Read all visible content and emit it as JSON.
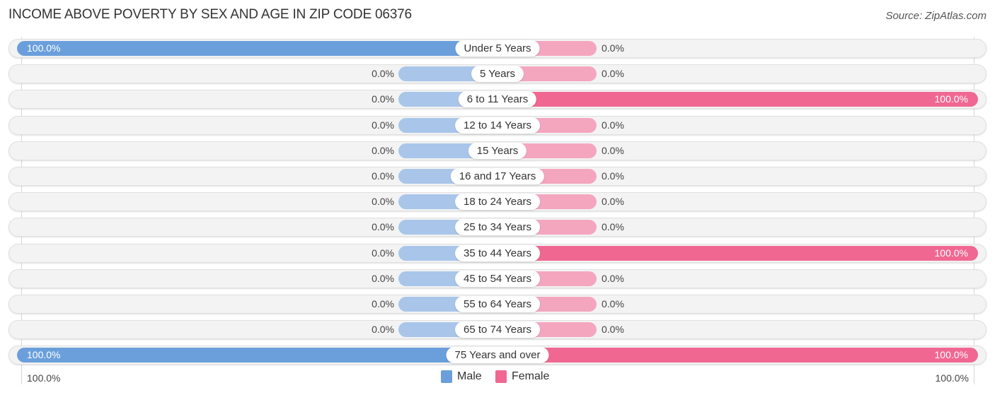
{
  "title": "INCOME ABOVE POVERTY BY SEX AND AGE IN ZIP CODE 06376",
  "source": "Source: ZipAtlas.com",
  "colors": {
    "male_full": "#6a9fdb",
    "male_stub": "#a9c6ea",
    "female_full": "#f06892",
    "female_stub": "#f5a6bf"
  },
  "legend": {
    "male": "Male",
    "female": "Female"
  },
  "axis": {
    "left_label": "100.0%",
    "right_label": "100.0%"
  },
  "chart_data": {
    "type": "bar",
    "orientation": "horizontal-diverging",
    "title": "INCOME ABOVE POVERTY BY SEX AND AGE IN ZIP CODE 06376",
    "xlabel": "",
    "ylabel": "",
    "xlim": [
      -100,
      100
    ],
    "legend_position": "bottom-center",
    "categories": [
      "Under 5 Years",
      "5 Years",
      "6 to 11 Years",
      "12 to 14 Years",
      "15 Years",
      "16 and 17 Years",
      "18 to 24 Years",
      "25 to 34 Years",
      "35 to 44 Years",
      "45 to 54 Years",
      "55 to 64 Years",
      "65 to 74 Years",
      "75 Years and over"
    ],
    "series": [
      {
        "name": "Male",
        "values": [
          100,
          0,
          0,
          0,
          0,
          0,
          0,
          0,
          0,
          0,
          0,
          0,
          100
        ],
        "labels": [
          "100.0%",
          "0.0%",
          "0.0%",
          "0.0%",
          "0.0%",
          "0.0%",
          "0.0%",
          "0.0%",
          "0.0%",
          "0.0%",
          "0.0%",
          "0.0%",
          "100.0%"
        ]
      },
      {
        "name": "Female",
        "values": [
          0,
          0,
          100,
          0,
          0,
          0,
          0,
          0,
          100,
          0,
          0,
          0,
          100
        ],
        "labels": [
          "0.0%",
          "0.0%",
          "100.0%",
          "0.0%",
          "0.0%",
          "0.0%",
          "0.0%",
          "0.0%",
          "100.0%",
          "0.0%",
          "0.0%",
          "0.0%",
          "100.0%"
        ]
      }
    ]
  }
}
